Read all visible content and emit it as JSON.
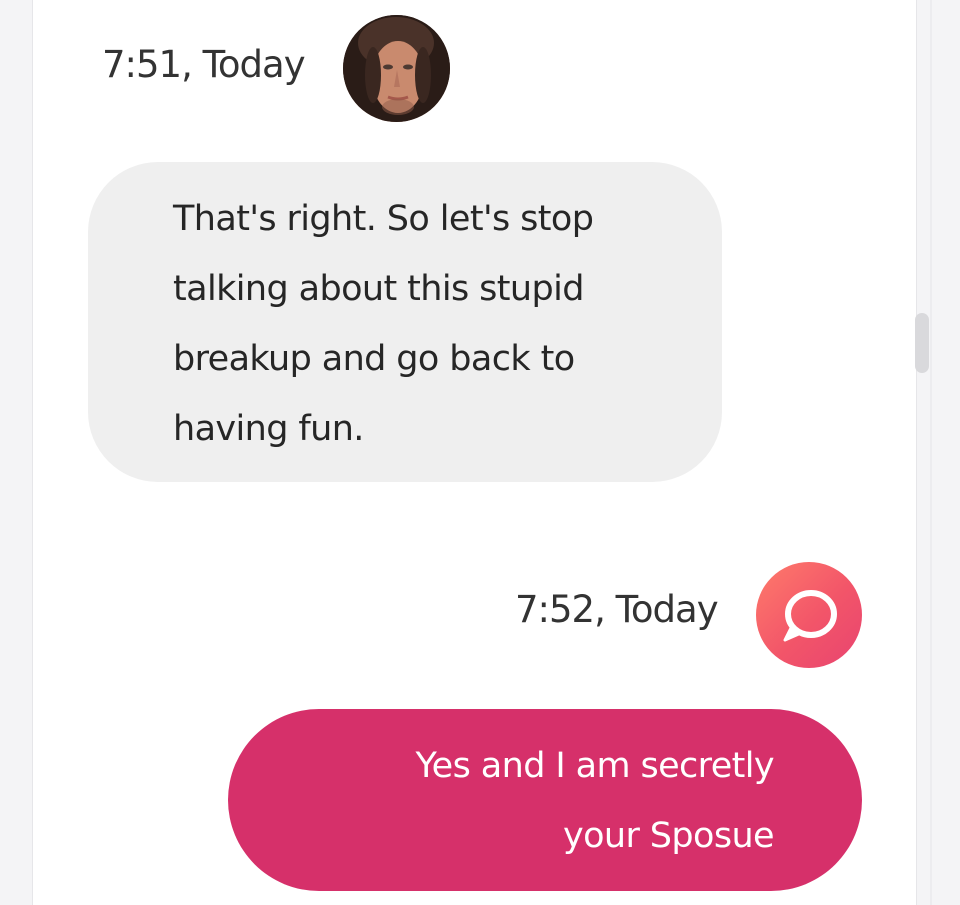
{
  "conversation": {
    "messages": [
      {
        "direction": "incoming",
        "timestamp": "7:51, Today",
        "avatar_icon": "profile-photo-avatar",
        "lines": [
          "That's right. So let's stop",
          "talking about this stupid",
          "breakup and go back to",
          "having fun."
        ],
        "bubble_color": "#efefef",
        "text_color": "#262626"
      },
      {
        "direction": "outgoing",
        "timestamp": "7:52, Today",
        "avatar_icon": "chat-bubble-icon",
        "lines": [
          "Yes and I am secretly",
          "your Sposue"
        ],
        "bubble_color": "#d6306a",
        "text_color": "#ffffff"
      }
    ]
  },
  "theme": {
    "accent_gradient_start": "#ff7b6b",
    "accent_gradient_end": "#e84470",
    "page_background": "#ffffff"
  }
}
